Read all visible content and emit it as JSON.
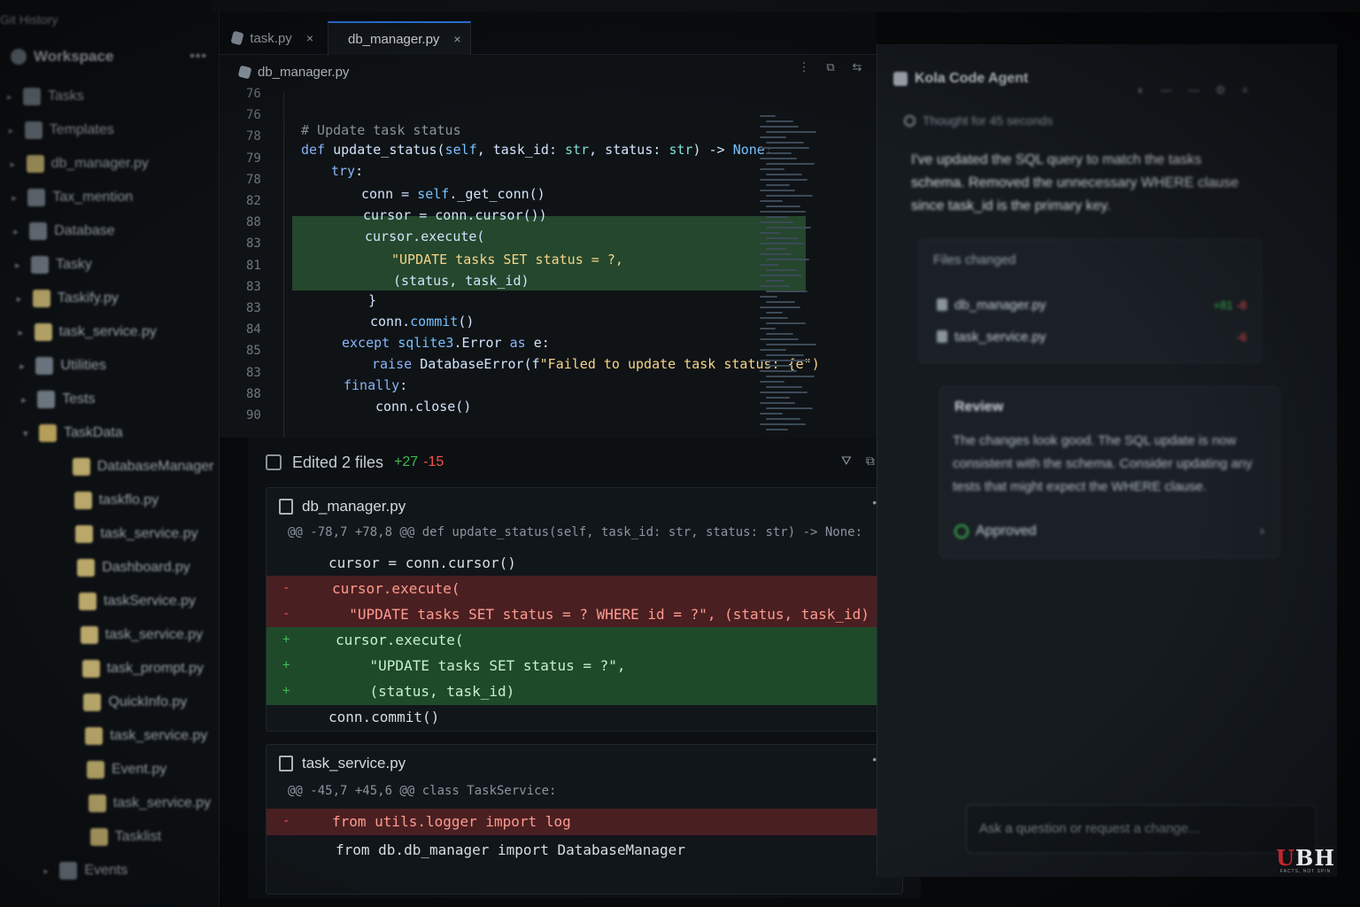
{
  "sidebar": {
    "top_text": "Git History",
    "header_title": "Workspace",
    "header_more": "•••",
    "items": [
      {
        "label": "Tasks",
        "indent": 0,
        "kind": "folder"
      },
      {
        "label": "Templates",
        "indent": 0,
        "kind": "folder"
      },
      {
        "label": "db_manager.py",
        "indent": 0,
        "kind": "file"
      },
      {
        "label": "Tax_mention",
        "indent": 0,
        "kind": "folder"
      },
      {
        "label": "Database",
        "indent": 0,
        "kind": "folder"
      },
      {
        "label": "Tasky",
        "indent": 0,
        "kind": "folder"
      },
      {
        "label": "Taskify.py",
        "indent": 0,
        "kind": "file"
      },
      {
        "label": "task_service.py",
        "indent": 0,
        "kind": "file"
      },
      {
        "label": "Utilities",
        "indent": 0,
        "kind": "folder"
      },
      {
        "label": "Tests",
        "indent": 0,
        "kind": "folder"
      },
      {
        "label": "TaskData",
        "indent": 0,
        "kind": "openfolder"
      },
      {
        "label": "DatabaseManager",
        "indent": 1,
        "kind": "file"
      },
      {
        "label": "taskflo.py",
        "indent": 1,
        "kind": "file"
      },
      {
        "label": "task_service.py",
        "indent": 1,
        "kind": "file"
      },
      {
        "label": "Dashboard.py",
        "indent": 1,
        "kind": "file"
      },
      {
        "label": "taskService.py",
        "indent": 1,
        "kind": "file"
      },
      {
        "label": "task_service.py",
        "indent": 1,
        "kind": "file"
      },
      {
        "label": "task_prompt.py",
        "indent": 1,
        "kind": "file"
      },
      {
        "label": "QuickInfo.py",
        "indent": 1,
        "kind": "file"
      },
      {
        "label": "task_service.py",
        "indent": 1,
        "kind": "file"
      },
      {
        "label": "Event.py",
        "indent": 1,
        "kind": "file"
      },
      {
        "label": "task_service.py",
        "indent": 1,
        "kind": "file"
      },
      {
        "label": "Tasklist",
        "indent": 1,
        "kind": "file"
      },
      {
        "label": "Events",
        "indent": 0,
        "kind": "folder"
      }
    ]
  },
  "editor": {
    "tabs": [
      {
        "label": "task.py",
        "close": "×",
        "active": false
      },
      {
        "label": "db_manager.py",
        "close": "×",
        "active": true
      }
    ],
    "breadcrumb": "db_manager.py",
    "actions": [
      "⋮",
      "⧉",
      "⇆"
    ],
    "line_numbers": [
      "76",
      "76",
      "78",
      "79",
      "78",
      "82",
      "88",
      "83",
      "81",
      "83",
      "83",
      "84",
      "85",
      "83",
      "88",
      "90"
    ],
    "code_lines": [
      {
        "parts": [
          [
            "cm",
            "# Update task status"
          ]
        ]
      },
      {
        "parts": [
          [
            "kw",
            "def "
          ],
          [
            "fn",
            "update_status("
          ],
          [
            "kw2",
            "self"
          ],
          [
            "fn",
            ", task_id: "
          ],
          [
            "ty",
            "str"
          ],
          [
            "fn",
            ", status: "
          ],
          [
            "ty",
            "str"
          ],
          [
            "fn",
            ") -> "
          ],
          [
            "kw2",
            "None"
          ],
          [
            "fn",
            ":"
          ]
        ]
      },
      {
        "parts": [
          [
            "kw",
            "try"
          ],
          [
            "fn",
            ":"
          ]
        ]
      },
      {
        "parts": [
          [
            "fn",
            "conn = "
          ],
          [
            "kw2",
            "self"
          ],
          [
            "fn",
            "._get_conn()"
          ]
        ]
      },
      {
        "parts": [
          [
            "fn",
            "cursor = conn.cursor())"
          ]
        ]
      },
      {
        "parts": [
          [
            "fn",
            "cursor.execute("
          ]
        ]
      },
      {
        "parts": [
          [
            "str",
            "\"UPDATE tasks SET status = ?,"
          ]
        ]
      },
      {
        "parts": [
          [
            "fn",
            "(status, task_id)"
          ]
        ]
      },
      {
        "parts": [
          [
            "fn",
            "}"
          ]
        ]
      },
      {
        "parts": [
          [
            "fn",
            "conn."
          ],
          [
            "kw2",
            "commit"
          ],
          [
            "fn",
            "()"
          ]
        ]
      },
      {
        "parts": [
          [
            "kw",
            "except "
          ],
          [
            "kw2",
            "sqlite3"
          ],
          [
            "fn",
            ".Error "
          ],
          [
            "kw",
            "as "
          ],
          [
            "fn",
            "e:"
          ]
        ]
      },
      {
        "parts": [
          [
            "kw",
            "raise "
          ],
          [
            "fn",
            "DatabaseError(f"
          ],
          [
            "str",
            "\"Failed to update task status: {e\")"
          ]
        ]
      },
      {
        "parts": [
          [
            "kw",
            "finally"
          ],
          [
            "fn",
            ":"
          ]
        ]
      },
      {
        "parts": [
          [
            "fn",
            "conn.close()"
          ]
        ]
      }
    ]
  },
  "diff": {
    "title": "Edited 2 files",
    "added": "+27",
    "removed": "-15",
    "actions": [
      "⛛",
      "⧉",
      "+"
    ],
    "files": [
      {
        "name": "db_manager.py",
        "more": "•••",
        "hunk": "@@ -78,7 +78,8 @@ def update_status(self, task_id: str, status: str) -> None:",
        "lines": [
          {
            "type": "ctx",
            "sign": "",
            "text": "cursor = conn.cursor()"
          },
          {
            "type": "del",
            "sign": "-",
            "text": "cursor.execute("
          },
          {
            "type": "del",
            "sign": "-",
            "text": "  \"UPDATE tasks SET status = ? WHERE id = ?\", (status, task_id)"
          },
          {
            "type": "add",
            "sign": "+",
            "text": "cursor.execute("
          },
          {
            "type": "add",
            "sign": "+",
            "text": "    \"UPDATE tasks SET status = ?\","
          },
          {
            "type": "add",
            "sign": "+",
            "text": "    (status, task_id)"
          },
          {
            "type": "ctx",
            "sign": "",
            "text": "conn.commit()"
          }
        ]
      },
      {
        "name": "task_service.py",
        "more": "•••",
        "hunk": "@@ -45,7 +45,6 @@ class TaskService:",
        "lines": [
          {
            "type": "del",
            "sign": "-",
            "text": "from utils.logger import log"
          },
          {
            "type": "ctx",
            "sign": "",
            "text": "from db.db_manager import DatabaseManager"
          }
        ]
      }
    ]
  },
  "agent": {
    "title": "Kola Code Agent",
    "icons": [
      "◐",
      "—",
      "—",
      "⚙",
      "×"
    ],
    "thought": "Thought for 45 seconds",
    "message": "I've updated the SQL query to match the tasks schema. Removed the unnecessary WHERE clause since task_id is the primary key.",
    "files_changed": {
      "title": "Files changed",
      "files": [
        {
          "name": "db_manager.py",
          "added": "+81",
          "removed": "-8"
        },
        {
          "name": "task_service.py",
          "added": "",
          "removed": "-6"
        }
      ]
    },
    "review": {
      "title": "Review",
      "text": "The changes look good. The SQL update is now consistent with the schema. Consider updating any tests that might expect the WHERE clause.",
      "status": "Approved",
      "chevron": "›"
    },
    "input_placeholder": "Ask a question or request a change..."
  },
  "watermark": {
    "mark_u": "U",
    "mark_rest": "BH",
    "tagline": "FACTS, NOT SPIN"
  },
  "colors": {
    "accent": "#2f81f7",
    "added": "#3fb950",
    "removed": "#f85149",
    "added_bg": "#1f4a2a",
    "removed_bg": "#4a1f22"
  }
}
